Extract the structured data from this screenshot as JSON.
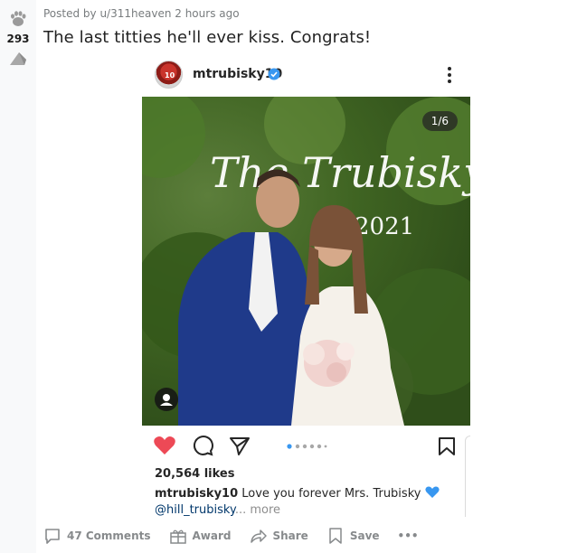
{
  "post": {
    "score": "293",
    "meta": "Posted by u/311heaven 2 hours ago",
    "title": "The last titties he'll ever kiss. Congrats!"
  },
  "instagram": {
    "username": "mtrubisky10",
    "avatar_badge": "10",
    "carousel_counter": "1/6",
    "image_text": [
      "The Trubiskys",
      "2021"
    ],
    "likes": "20,564 likes",
    "caption_user": "mtrubisky10",
    "caption_text": " Love you forever Mrs. Trubisky",
    "mention": "@hill_trubisky",
    "more": "... more",
    "carousel_dots": 6,
    "carousel_active_index": 0
  },
  "footer": {
    "comments": "47 Comments",
    "award": "Award",
    "share": "Share",
    "save": "Save",
    "more_label": "•••"
  },
  "colors": {
    "vote_bg": "#f8f9fa",
    "meta_text": "#787c7e",
    "heart": "#ed4956",
    "verified": "#3897f0",
    "carousel_active": "#3897f0",
    "footer_text": "#878a8c"
  }
}
